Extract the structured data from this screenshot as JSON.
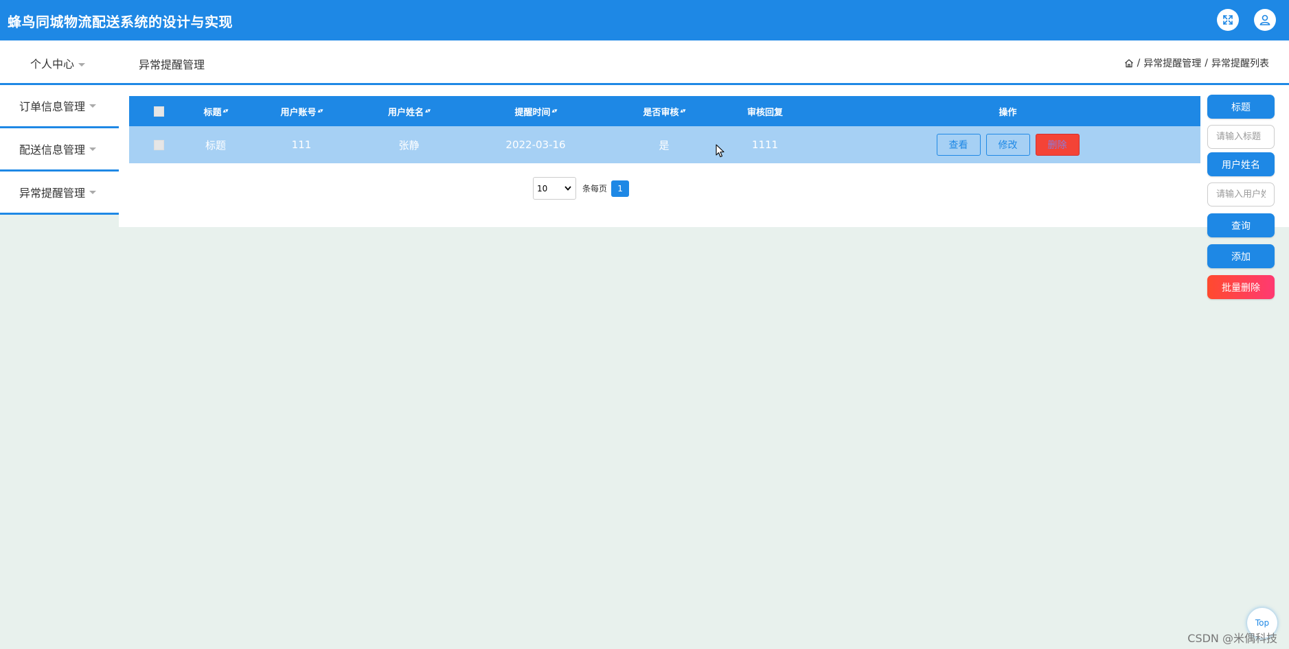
{
  "app": {
    "title": "蜂鸟同城物流配送系统的设计与实现",
    "accent_color": "#1e88e5",
    "icons": [
      "fullscreen-icon",
      "user-icon"
    ]
  },
  "nav": {
    "personal_center": "个人中心",
    "page_title": "异常提醒管理",
    "breadcrumb": [
      "异常提醒管理",
      "异常提醒列表"
    ],
    "breadcrumb_separator": "/"
  },
  "sidebar": {
    "items": [
      {
        "label": "订单信息管理"
      },
      {
        "label": "配送信息管理"
      },
      {
        "label": "异常提醒管理"
      }
    ]
  },
  "table": {
    "columns": [
      "标题",
      "用户账号",
      "用户姓名",
      "提醒时间",
      "是否审核",
      "审核回复",
      "操作"
    ],
    "rows": [
      {
        "title": "标题",
        "account": "111",
        "name": "张静",
        "time": "2022-03-16",
        "audited": "是",
        "reply": "1111",
        "actions": {
          "view": "查看",
          "edit": "修改",
          "delete": "删除"
        }
      }
    ]
  },
  "pagination": {
    "page_size": "10",
    "page_size_options": [
      "10"
    ],
    "per_page_label": "条每页",
    "current_page": "1"
  },
  "search_panel": {
    "title_label": "标题",
    "title_placeholder": "请输入标题",
    "name_label": "用户姓名",
    "name_placeholder": "请输入用户姓名",
    "query_button": "查询",
    "add_button": "添加",
    "batch_delete_button": "批量删除"
  },
  "back_to_top": "Top",
  "watermark": "CSDN @米偶科技"
}
